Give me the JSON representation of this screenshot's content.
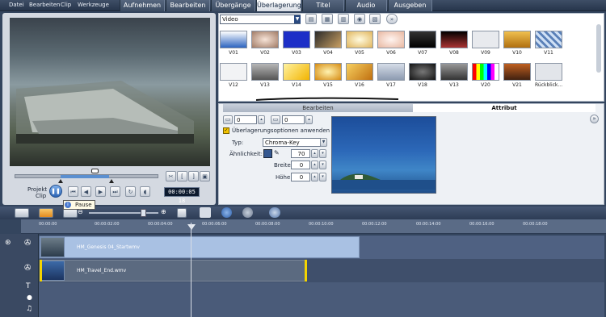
{
  "menu": [
    "Datei",
    "Bearbeiten",
    "Clip",
    "Werkzeuge"
  ],
  "tabs": [
    {
      "label": "Aufnehmen",
      "active": false
    },
    {
      "label": "Bearbeiten",
      "active": false
    },
    {
      "label": "Übergänge",
      "active": false
    },
    {
      "label": "Überlagerung",
      "active": true
    },
    {
      "label": "Titel",
      "active": false
    },
    {
      "label": "Audio",
      "active": false
    },
    {
      "label": "Ausgeben",
      "active": false
    }
  ],
  "preview": {
    "mode_project": "Projekt",
    "mode_clip": "Clip",
    "timecode": "00:00:05 18",
    "tooltip": "Pause"
  },
  "library": {
    "category": "Video",
    "row1": [
      "V01",
      "V02",
      "V03",
      "V04",
      "V05",
      "V06",
      "V07",
      "V08",
      "V09",
      "V10",
      "V11"
    ],
    "row2": [
      "V12",
      "V13",
      "V14",
      "V15",
      "V16",
      "V17",
      "V18",
      "V13",
      "V20",
      "V21",
      "Rückblick..."
    ]
  },
  "attr": {
    "tab_edit": "Bearbeiten",
    "tab_attr": "Attribut",
    "field1": "0",
    "field2": "0",
    "overlay_option": "Überlagerungsoptionen anwenden",
    "typ_label": "Typ:",
    "typ_value": "Chroma-Key",
    "similarity_label": "Ähnlichkeit:",
    "similarity_value": "70",
    "width_label": "Breite:",
    "width_value": "0",
    "height_label": "Höhe:",
    "height_value": "0"
  },
  "ruler": [
    "00:00:00",
    "00:00:02:00",
    "00:00:04:00",
    "00:00:06:00",
    "00:00:08:00",
    "00:00:10:00",
    "00:00:12:00",
    "00:00:14:00",
    "00:00:16:00",
    "00:00:18:00"
  ],
  "timeline": {
    "clip1": "HM_Genesis 04_Startwmv",
    "clip2": "HM_Travel_End.wmv"
  },
  "colors": {
    "accent": "#5a8fd0",
    "active_tab": "#ffffff",
    "clip1": "#a9c1e3",
    "clip2": "#5b6a80"
  }
}
